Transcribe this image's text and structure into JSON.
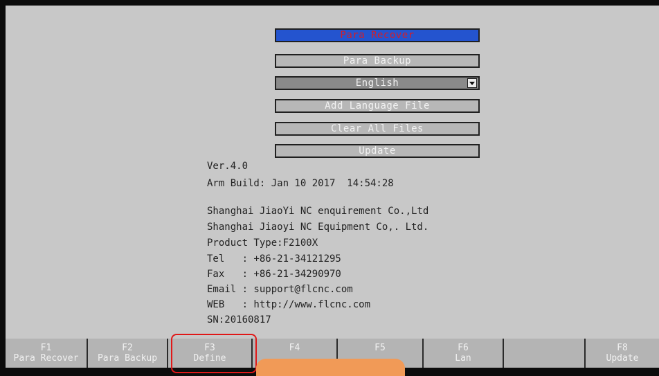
{
  "menu": {
    "para_recover": "Para Recover",
    "para_backup": "Para Backup",
    "language": "English",
    "add_language": "Add Language File",
    "clear_files": "Clear All Files",
    "update": "Update"
  },
  "info": {
    "version": "Ver.4.0",
    "build": "Arm Build: Jan 10 2017  14:54:28",
    "company_1": "Shanghai JiaoYi NC enquirement Co.,Ltd",
    "company_2": "Shanghai Jiaoyi NC Equipment Co,. Ltd.",
    "product": "Product Type:F2100X",
    "tel": "Tel   : +86-21-34121295",
    "fax": "Fax   : +86-21-34290970",
    "email": "Email : support@flcnc.com",
    "web": "WEB   : http://www.flcnc.com",
    "sn": "SN:20160817"
  },
  "fkeys": [
    {
      "key": "F1",
      "label": "Para Recover"
    },
    {
      "key": "F2",
      "label": "Para Backup"
    },
    {
      "key": "F3",
      "label": "Define"
    },
    {
      "key": "F4",
      "label": ""
    },
    {
      "key": "F5",
      "label": ""
    },
    {
      "key": "F6",
      "label": "Lan"
    },
    {
      "key": "",
      "label": ""
    },
    {
      "key": "F8",
      "label": "Update"
    }
  ]
}
